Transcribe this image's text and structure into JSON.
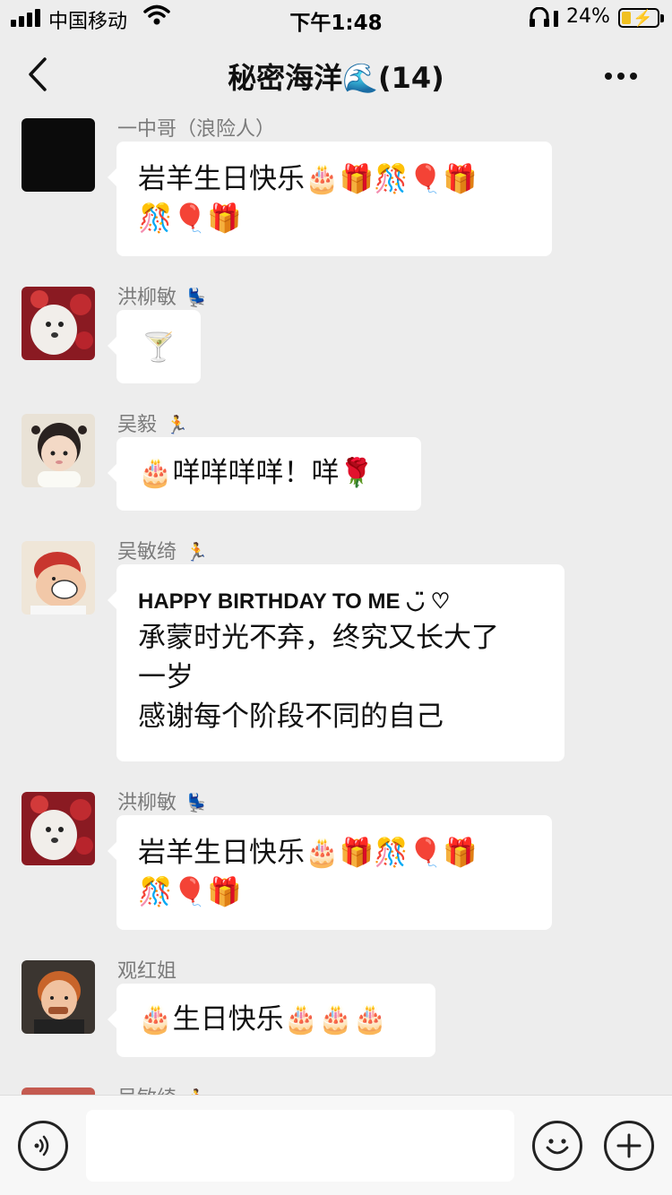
{
  "status_bar": {
    "carrier": "中国移动",
    "time": "下午1:48",
    "battery_percent": "24%"
  },
  "nav": {
    "title": "秘密海洋🌊(14)"
  },
  "messages": [
    {
      "sender": "一中哥（浪险人）",
      "badge": "",
      "lines": [
        "岩羊生日快乐🎂🎁🎊🎈🎁",
        "🎊🎈🎁"
      ]
    },
    {
      "sender": "洪柳敏",
      "badge": "💺",
      "lines": [
        "🍸"
      ]
    },
    {
      "sender": "吴毅",
      "badge": "🏃",
      "lines": [
        "🎂咩咩咩咩！咩🌹"
      ]
    },
    {
      "sender": "吴敏绮",
      "badge": "🏃",
      "lines": [
        "HAPPY BIRTHDAY TO ME ◡̈ ♡",
        "承蒙时光不弃，终究又长大了",
        "一岁",
        "感谢每个阶段不同的自己"
      ]
    },
    {
      "sender": "洪柳敏",
      "badge": "💺",
      "lines": [
        "岩羊生日快乐🎂🎁🎊🎈🎁",
        "🎊🎈🎁"
      ]
    },
    {
      "sender": "观红姐",
      "badge": "",
      "lines": [
        "🎂生日快乐🎂🎂🎂"
      ]
    },
    {
      "sender": "吴敏绮",
      "badge": "🏃",
      "lines": []
    }
  ],
  "colors": {
    "background": "#ededed",
    "bubble": "#ffffff",
    "sender_text": "#7b7b7b"
  },
  "icons": {
    "back": "chevron-left-icon",
    "more": "more-dots-icon",
    "voice": "voice-icon",
    "emoji": "emoji-icon",
    "plus": "plus-icon"
  }
}
